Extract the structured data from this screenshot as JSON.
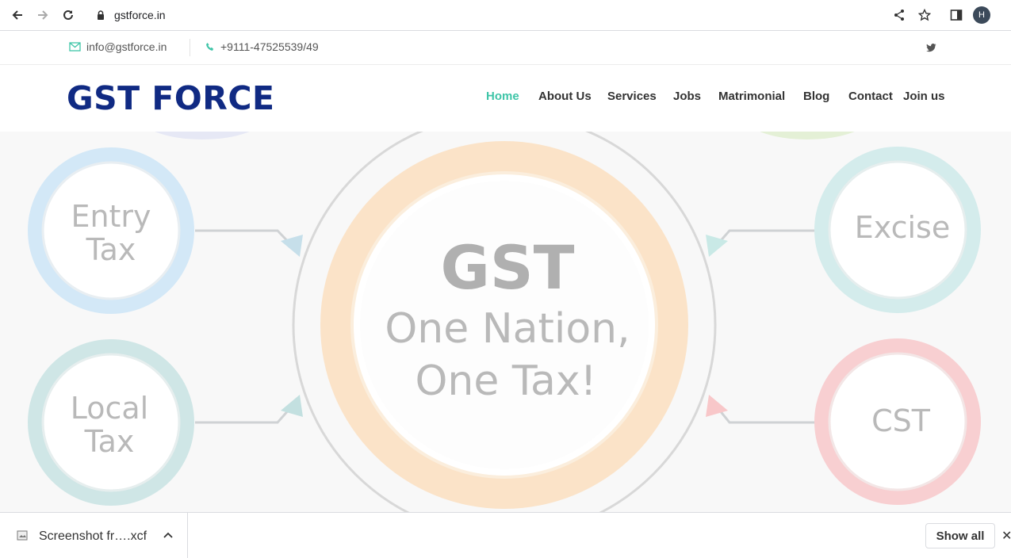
{
  "browser": {
    "url": "gstforce.in",
    "avatar_letter": "H"
  },
  "topbar": {
    "email": "info@gstforce.in",
    "phone": "+9111-47525539/49",
    "accent_color": "#3fc5a8"
  },
  "header": {
    "logo_text": "GST FORCE",
    "logo_color": "#102a83",
    "nav": [
      {
        "label": "Home",
        "active": true
      },
      {
        "label": "About Us",
        "active": false
      },
      {
        "label": "Services",
        "active": false
      },
      {
        "label": "Jobs",
        "active": false
      },
      {
        "label": "Matrimonial",
        "active": false
      },
      {
        "label": "Blog",
        "active": false
      },
      {
        "label": "Contact",
        "active": false
      },
      {
        "label": "Join us",
        "active": false
      }
    ]
  },
  "hero": {
    "center_title": "GST",
    "center_line1": "One Nation,",
    "center_line2": "One Tax!",
    "circles": {
      "entry_1": "Entry",
      "entry_2": "Tax",
      "local_1": "Local",
      "local_2": "Tax",
      "excise": "Excise",
      "cst": "CST"
    }
  },
  "downloads": {
    "file_name": "Screenshot fr….xcf",
    "show_all_label": "Show all"
  }
}
